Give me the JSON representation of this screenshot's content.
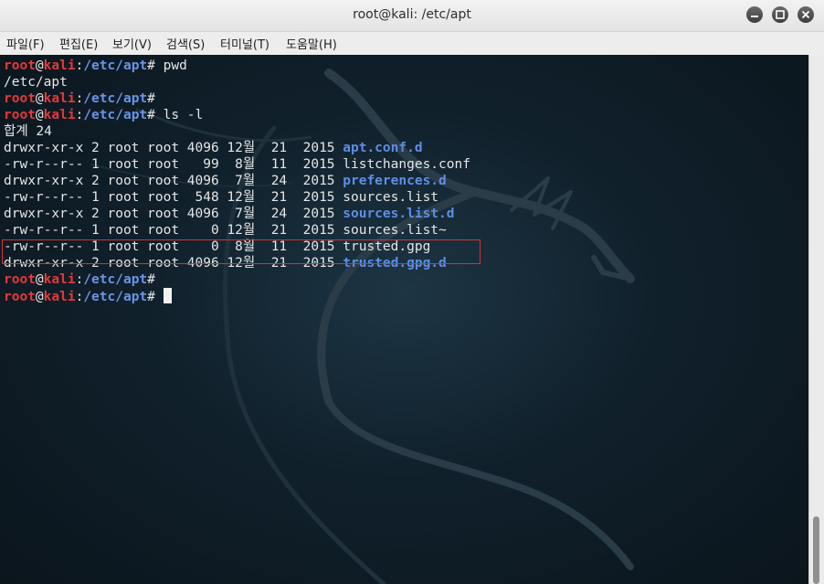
{
  "window": {
    "title": "root@kali: /etc/apt"
  },
  "menu": [
    "파일(F)",
    "편집(E)",
    "보기(V)",
    "검색(S)",
    "터미널(T)",
    "도움말(H)"
  ],
  "prompt": {
    "user": "root",
    "at": "@",
    "host": "kali",
    "sep": ":",
    "symbol": "#"
  },
  "terminal_lines": [
    {
      "type": "prompt",
      "path": "/etc/apt",
      "cmd": " pwd"
    },
    {
      "type": "text",
      "text": "/etc/apt"
    },
    {
      "type": "prompt",
      "path": "/etc/apt",
      "cmd": ""
    },
    {
      "type": "prompt",
      "path": "/etc/apt",
      "cmd": " ls -l"
    },
    {
      "type": "text",
      "text": "합계 24"
    },
    {
      "type": "ls",
      "perm": "drwxr-xr-x",
      "links": "2",
      "owner": "root",
      "group": "root",
      "size": "4096",
      "month": "12월",
      "day": "21",
      "year": "2015",
      "name": "apt.conf.d",
      "is_dir": true
    },
    {
      "type": "ls",
      "perm": "-rw-r--r--",
      "links": "1",
      "owner": "root",
      "group": "root",
      "size": "99",
      "month": "8월",
      "day": "11",
      "year": "2015",
      "name": "listchanges.conf",
      "is_dir": false
    },
    {
      "type": "ls",
      "perm": "drwxr-xr-x",
      "links": "2",
      "owner": "root",
      "group": "root",
      "size": "4096",
      "month": "7월",
      "day": "24",
      "year": "2015",
      "name": "preferences.d",
      "is_dir": true
    },
    {
      "type": "ls",
      "perm": "-rw-r--r--",
      "links": "1",
      "owner": "root",
      "group": "root",
      "size": "548",
      "month": "12월",
      "day": "21",
      "year": "2015",
      "name": "sources.list",
      "is_dir": false,
      "highlighted": true
    },
    {
      "type": "ls",
      "perm": "drwxr-xr-x",
      "links": "2",
      "owner": "root",
      "group": "root",
      "size": "4096",
      "month": "7월",
      "day": "24",
      "year": "2015",
      "name": "sources.list.d",
      "is_dir": true
    },
    {
      "type": "ls",
      "perm": "-rw-r--r--",
      "links": "1",
      "owner": "root",
      "group": "root",
      "size": "0",
      "month": "12월",
      "day": "21",
      "year": "2015",
      "name": "sources.list~",
      "is_dir": false
    },
    {
      "type": "ls",
      "perm": "-rw-r--r--",
      "links": "1",
      "owner": "root",
      "group": "root",
      "size": "0",
      "month": "8월",
      "day": "11",
      "year": "2015",
      "name": "trusted.gpg",
      "is_dir": false
    },
    {
      "type": "ls",
      "perm": "drwxr-xr-x",
      "links": "2",
      "owner": "root",
      "group": "root",
      "size": "4096",
      "month": "12월",
      "day": "21",
      "year": "2015",
      "name": "trusted.gpg.d",
      "is_dir": true
    },
    {
      "type": "prompt",
      "path": "/etc/apt",
      "cmd": ""
    },
    {
      "type": "prompt",
      "path": "/etc/apt",
      "cmd": "",
      "cursor": true
    }
  ],
  "colors": {
    "user": "#e23a3a",
    "path": "#6b94e6",
    "dir": "#5e8ee6",
    "highlight_box": "#d9312f",
    "terminal_bg": "#10202b"
  },
  "icons": {
    "minimize": "minimize-icon",
    "maximize": "maximize-icon",
    "close": "close-icon",
    "background": "kali-dragon-logo"
  }
}
